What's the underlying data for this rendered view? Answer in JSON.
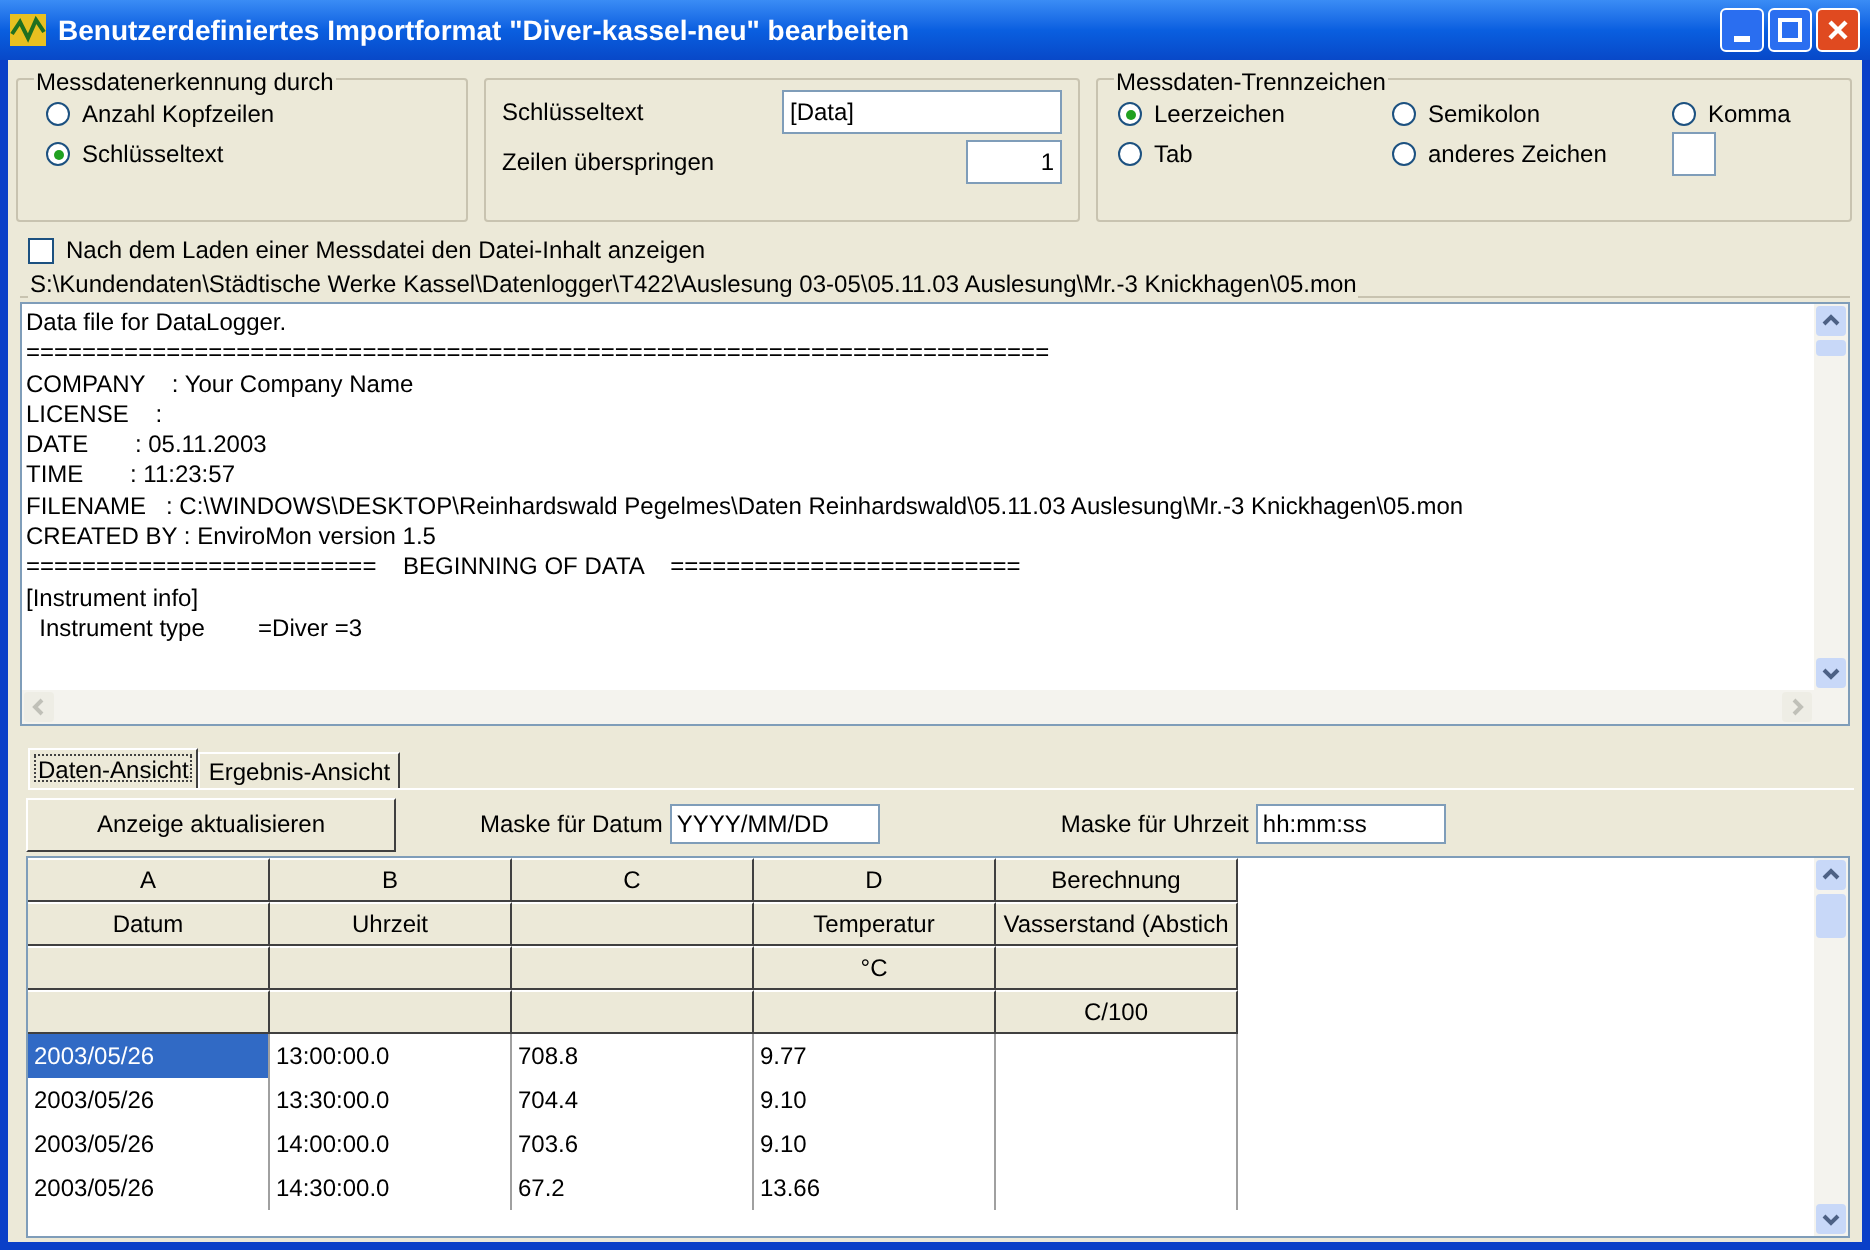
{
  "window": {
    "title": "Benutzerdefiniertes Importformat \"Diver-kassel-neu\" bearbeiten"
  },
  "detection": {
    "title": "Messdatenerkennung durch",
    "options": [
      {
        "label": "Anzahl Kopfzeilen",
        "selected": false
      },
      {
        "label": "Schlüsseltext",
        "selected": true
      }
    ]
  },
  "key_fields": {
    "key_label": "Schlüsseltext",
    "key_value": "[Data]",
    "skip_label": "Zeilen überspringen",
    "skip_value": "1"
  },
  "separator": {
    "title": "Messdaten-Trennzeichen",
    "options": [
      {
        "label": "Leerzeichen",
        "selected": true
      },
      {
        "label": "Semikolon",
        "selected": false
      },
      {
        "label": "Komma",
        "selected": false
      },
      {
        "label": "Tab",
        "selected": false
      },
      {
        "label": "anderes Zeichen",
        "selected": false
      }
    ]
  },
  "show_content": {
    "label": "Nach dem Laden einer Messdatei den Datei-Inhalt anzeigen",
    "checked": false
  },
  "file_path": "S:\\Kundendaten\\Städtische Werke Kassel\\Datenlogger\\T422\\Auslesung 03-05\\05.11.03 Auslesung\\Mr.-3 Knickhagen\\05.mon",
  "file_lines": [
    "Data file for DataLogger.",
    "=========================================================================",
    "COMPANY    : Your Company Name",
    "LICENSE    :",
    "DATE       : 05.11.2003",
    "TIME       : 11:23:57",
    "FILENAME   : C:\\WINDOWS\\DESKTOP\\Reinhardswald Pegelmes\\Daten Reinhardswald\\05.11.03 Auslesung\\Mr.-3 Knickhagen\\05.mon",
    "CREATED BY : EnviroMon version 1.5",
    "=========================    BEGINNING OF DATA    =========================",
    "[Instrument info]",
    "  Instrument type        =Diver =3"
  ],
  "tabs": [
    {
      "label": "Daten-Ansicht",
      "selected": true
    },
    {
      "label": "Ergebnis-Ansicht",
      "selected": false
    }
  ],
  "refresh_button": "Anzeige aktualisieren",
  "date_mask": {
    "label": "Maske für Datum",
    "value": "YYYY/MM/DD"
  },
  "time_mask": {
    "label": "Maske für Uhrzeit",
    "value": "hh:mm:ss"
  },
  "grid": {
    "columns": [
      {
        "letter": "A",
        "name": "Datum"
      },
      {
        "letter": "B",
        "name": "Uhrzeit"
      },
      {
        "letter": "C"
      },
      {
        "letter": "D",
        "name": "Temperatur",
        "unit": "°C"
      },
      {
        "letter": "Berechnung",
        "name": "Vasserstand (Abstich",
        "formula": "C/100"
      }
    ],
    "rows": [
      {
        "cells": [
          {
            "text": "2003/05/26",
            "selected": true
          },
          {
            "text": "13:00:00.0",
            "selected": false
          },
          {
            "text": "708.8",
            "selected": false
          },
          {
            "text": "9.77",
            "selected": false
          }
        ]
      },
      {
        "cells": [
          {
            "text": "2003/05/26",
            "selected": false
          },
          {
            "text": "13:30:00.0",
            "selected": false
          },
          {
            "text": "704.4",
            "selected": false
          },
          {
            "text": "9.10",
            "selected": false
          }
        ]
      },
      {
        "cells": [
          {
            "text": "2003/05/26",
            "selected": false
          },
          {
            "text": "14:00:00.0",
            "selected": false
          },
          {
            "text": "703.6",
            "selected": false
          },
          {
            "text": "9.10",
            "selected": false
          }
        ]
      },
      {
        "cells": [
          {
            "text": "2003/05/26",
            "selected": false
          },
          {
            "text": "14:30:00.0",
            "selected": false
          },
          {
            "text": "67.2",
            "selected": false
          },
          {
            "text": "13.66",
            "selected": false
          }
        ]
      }
    ]
  }
}
